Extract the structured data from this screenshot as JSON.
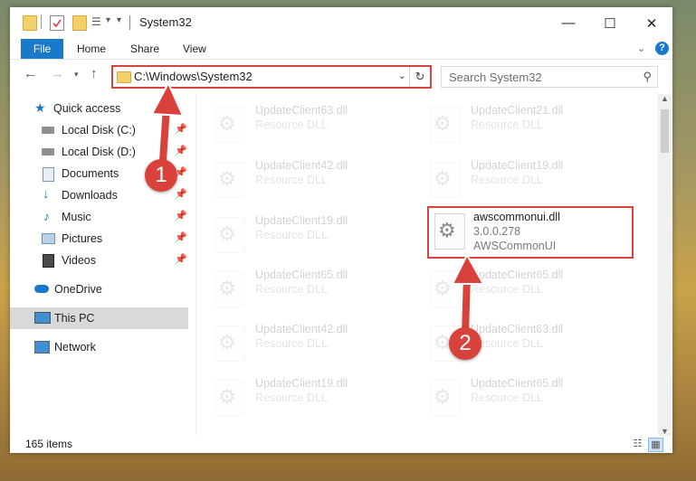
{
  "window": {
    "title": "System32",
    "controls": {
      "minimize": "—",
      "maximize": "☐",
      "close": "✕"
    }
  },
  "ribbon": {
    "tabs": [
      "File",
      "Home",
      "Share",
      "View"
    ],
    "expand_icon": "chevron-down-icon",
    "help_icon": "help-icon"
  },
  "address_bar": {
    "path": "C:\\Windows\\System32",
    "icon": "folder-icon"
  },
  "search": {
    "placeholder": "Search System32"
  },
  "sidebar": {
    "items": [
      {
        "label": "Quick access",
        "icon": "star-icon",
        "pinned": false
      },
      {
        "label": "Local Disk (C:)",
        "icon": "drive-icon",
        "pinned": true
      },
      {
        "label": "Local Disk (D:)",
        "icon": "drive-icon",
        "pinned": true
      },
      {
        "label": "Documents",
        "icon": "documents-icon",
        "pinned": true
      },
      {
        "label": "Downloads",
        "icon": "download-icon",
        "pinned": true
      },
      {
        "label": "Music",
        "icon": "music-icon",
        "pinned": true
      },
      {
        "label": "Pictures",
        "icon": "pictures-icon",
        "pinned": true
      },
      {
        "label": "Videos",
        "icon": "videos-icon",
        "pinned": true
      },
      {
        "label": "OneDrive",
        "icon": "cloud-icon",
        "pinned": false
      },
      {
        "label": "This PC",
        "icon": "computer-icon",
        "pinned": false
      },
      {
        "label": "Network",
        "icon": "network-icon",
        "pinned": false
      }
    ],
    "selected": "This PC"
  },
  "files": {
    "left_column": [
      {
        "name": "UpdateClient63.dll",
        "type": "Resource DLL"
      },
      {
        "name": "UpdateClient42.dll",
        "type": "Resource DLL"
      },
      {
        "name": "UpdateClient19.dll",
        "type": "Resource DLL"
      },
      {
        "name": "UpdateClient65.dll",
        "type": "Resource DLL"
      },
      {
        "name": "UpdateClient42.dll",
        "type": "Resource DLL"
      },
      {
        "name": "UpdateClient19.dll",
        "type": "Resource DLL"
      }
    ],
    "right_column": [
      {
        "name": "UpdateClient21.dll",
        "type": "Resource DLL"
      },
      {
        "name": "UpdateClient19.dll",
        "type": "Resource DLL"
      },
      {
        "name": "UpdateClient65.dll",
        "type": "Resource DLL"
      },
      {
        "name": "UpdateClient63.dll",
        "type": "Resource DLL"
      },
      {
        "name": "UpdateClient65.dll",
        "type": "Resource DLL"
      }
    ],
    "highlighted": {
      "name": "awscommonui.dll",
      "version": "3.0.0.278",
      "description": "AWSCommonUI"
    }
  },
  "status": {
    "item_count": "165 items"
  },
  "callouts": {
    "step1": "1",
    "step2": "2"
  },
  "colors": {
    "accent": "#1979ca",
    "highlight": "#d9423a",
    "selected_bg": "#d9d9d9"
  }
}
